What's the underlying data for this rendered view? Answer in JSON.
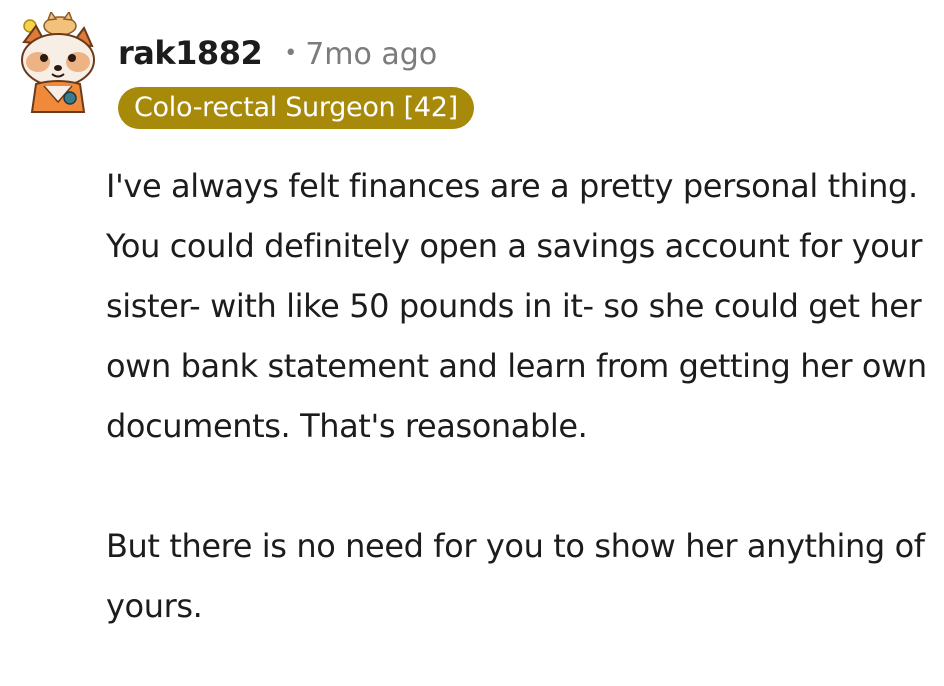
{
  "comment": {
    "username": "rak1882",
    "separator": "•",
    "timestamp": "7mo ago",
    "flair": "Colo-rectal Surgeon [42]",
    "flair_color": "#a88a0a",
    "avatar_icon": "red-panda-avatar-icon",
    "paragraphs": [
      "I've always felt finances are a pretty personal thing. You could definitely open a savings account for your sister- with like 50 pounds in it- so she could get her own bank statement and learn from getting her own documents. That's reasonable.",
      "But there is no need for you to show her anything of yours."
    ]
  }
}
